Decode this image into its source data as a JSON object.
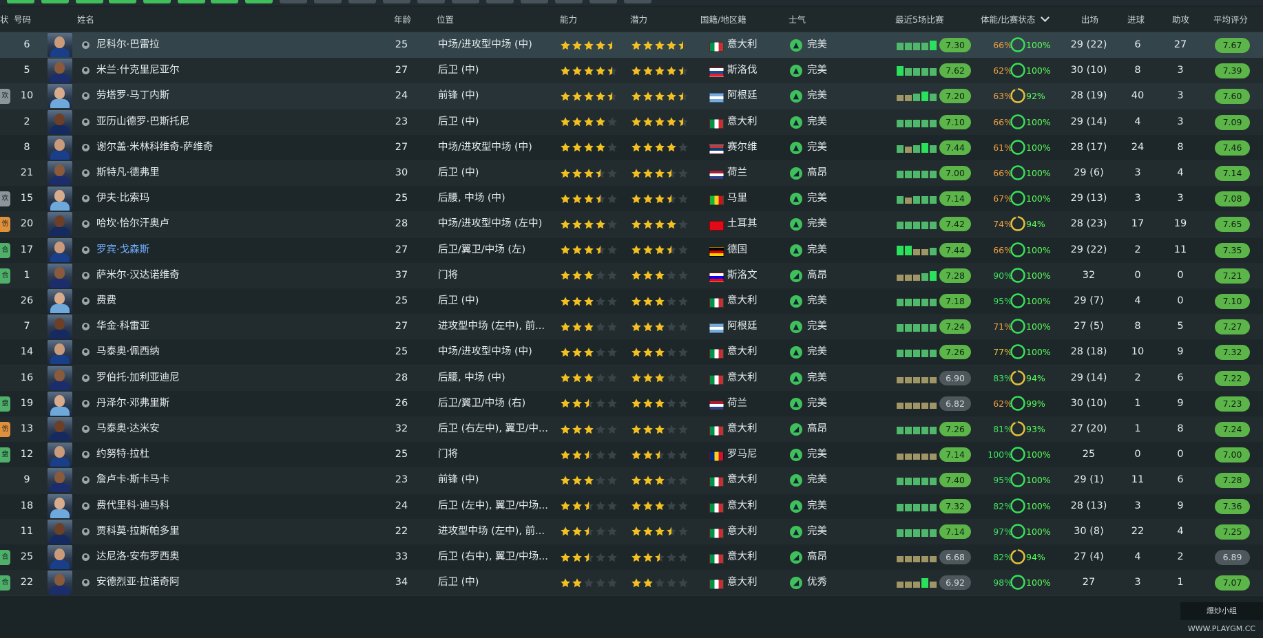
{
  "colors": {
    "good": "#3fc05a",
    "great": "#1ee05a",
    "warn": "#e4c23a",
    "grey": "#525c60",
    "orange": "#f0a040"
  },
  "header": {
    "status_col": "状",
    "number": "号码",
    "name": "姓名",
    "age": "年龄",
    "position": "位置",
    "ability": "能力",
    "potential": "潜力",
    "nationality": "国籍/地区籍",
    "morale": "士气",
    "recent_form": "最近5场比赛",
    "condition": "体能/比赛状态",
    "apps": "出场",
    "goals": "进球",
    "assists": "助攻",
    "avg_rating": "平均评分"
  },
  "players": [
    {
      "tag": "",
      "tag_color": "",
      "number": "6",
      "name": "尼科尔·巴雷拉",
      "age": "25",
      "position": "中场/进攻型中场 (中)",
      "ca": 4.5,
      "pa": 4.5,
      "flag": "italy",
      "nation": "意大利",
      "morale": "完美",
      "morale_icon": "up-icon",
      "form": [
        2,
        2,
        2,
        2,
        3
      ],
      "last": "7.30",
      "last_color": "good",
      "fitness": "66%",
      "fit_color": "orange",
      "cond": "100%",
      "apps": "29 (22)",
      "goals": "6",
      "assists": "27",
      "avg": "7.67",
      "avg_color": "good"
    },
    {
      "tag": "",
      "tag_color": "",
      "number": "5",
      "name": "米兰·什克里尼亚尔",
      "age": "27",
      "position": "后卫 (中)",
      "ca": 4.5,
      "pa": 4.5,
      "flag": "slovakia",
      "nation": "斯洛伐",
      "morale": "完美",
      "morale_icon": "up-icon",
      "form": [
        3,
        2,
        2,
        2,
        2
      ],
      "last": "7.62",
      "last_color": "good",
      "fitness": "62%",
      "fit_color": "orange",
      "cond": "100%",
      "apps": "30 (10)",
      "goals": "8",
      "assists": "3",
      "avg": "7.39",
      "avg_color": "good"
    },
    {
      "tag": "欢",
      "tag_color": "#8b959a",
      "number": "10",
      "name": "劳塔罗·马丁内斯",
      "age": "24",
      "position": "前锋 (中)",
      "ca": 4.5,
      "pa": 4.5,
      "flag": "argentina",
      "nation": "阿根廷",
      "morale": "完美",
      "morale_icon": "up-icon",
      "form": [
        1,
        1,
        2,
        3,
        2
      ],
      "last": "7.20",
      "last_color": "good",
      "fitness": "63%",
      "fit_color": "orange",
      "cond": "92%",
      "apps": "28 (19)",
      "goals": "40",
      "assists": "3",
      "avg": "7.60",
      "avg_color": "good"
    },
    {
      "tag": "",
      "tag_color": "",
      "number": "2",
      "name": "亚历山德罗·巴斯托尼",
      "age": "23",
      "position": "后卫 (中)",
      "ca": 4,
      "pa": 4.5,
      "flag": "italy",
      "nation": "意大利",
      "morale": "完美",
      "morale_icon": "up-icon",
      "form": [
        2,
        2,
        2,
        2,
        2
      ],
      "last": "7.10",
      "last_color": "good",
      "fitness": "66%",
      "fit_color": "orange",
      "cond": "100%",
      "apps": "29 (14)",
      "goals": "4",
      "assists": "3",
      "avg": "7.09",
      "avg_color": "good"
    },
    {
      "tag": "",
      "tag_color": "",
      "number": "8",
      "name": "谢尔盖·米林科维奇-萨维奇",
      "age": "27",
      "position": "中场/进攻型中场 (中)",
      "ca": 4,
      "pa": 4,
      "flag": "serbia",
      "nation": "赛尔维",
      "morale": "完美",
      "morale_icon": "up-icon",
      "form": [
        2,
        1,
        2,
        3,
        2
      ],
      "last": "7.44",
      "last_color": "good",
      "fitness": "61%",
      "fit_color": "orange",
      "cond": "100%",
      "apps": "28 (17)",
      "goals": "24",
      "assists": "8",
      "avg": "7.46",
      "avg_color": "good"
    },
    {
      "tag": "",
      "tag_color": "",
      "number": "21",
      "name": "斯特凡·德弗里",
      "age": "30",
      "position": "后卫 (中)",
      "ca": 3.5,
      "pa": 3.5,
      "flag": "netherlands",
      "nation": "荷兰",
      "morale": "高昂",
      "morale_icon": "flag-icon",
      "form": [
        2,
        2,
        2,
        2,
        2
      ],
      "last": "7.00",
      "last_color": "good",
      "fitness": "66%",
      "fit_color": "orange",
      "cond": "100%",
      "apps": "29 (6)",
      "goals": "3",
      "assists": "4",
      "avg": "7.14",
      "avg_color": "good"
    },
    {
      "tag": "欢",
      "tag_color": "#8b959a",
      "number": "15",
      "name": "伊夫·比索玛",
      "age": "25",
      "position": "后腰, 中场 (中)",
      "ca": 3.5,
      "pa": 3.5,
      "flag": "mali",
      "nation": "马里",
      "morale": "完美",
      "morale_icon": "up-icon",
      "form": [
        2,
        1,
        2,
        2,
        2
      ],
      "last": "7.14",
      "last_color": "good",
      "fitness": "67%",
      "fit_color": "orange",
      "cond": "100%",
      "apps": "29 (13)",
      "goals": "3",
      "assists": "3",
      "avg": "7.08",
      "avg_color": "good"
    },
    {
      "tag": "伤",
      "tag_color": "#e0903a",
      "number": "20",
      "name": "哈坎·恰尔汗奥卢",
      "age": "28",
      "position": "中场/进攻型中场 (左中)",
      "ca": 4,
      "pa": 4,
      "flag": "turkey",
      "nation": "土耳其",
      "morale": "完美",
      "morale_icon": "up-icon",
      "form": [
        2,
        2,
        2,
        2,
        2
      ],
      "last": "7.42",
      "last_color": "good",
      "fitness": "74%",
      "fit_color": "orange",
      "cond": "94%",
      "apps": "28 (23)",
      "goals": "17",
      "assists": "19",
      "avg": "7.65",
      "avg_color": "good"
    },
    {
      "tag": "合",
      "tag_color": "#4fb06a",
      "number": "17",
      "name": "罗宾·戈森斯",
      "age": "27",
      "position": "后卫/翼卫/中场 (左)",
      "ca": 3.5,
      "pa": 3.5,
      "flag": "germany",
      "nation": "德国",
      "morale": "完美",
      "morale_icon": "up-icon",
      "form": [
        3,
        3,
        1,
        1,
        2
      ],
      "last": "7.44",
      "last_color": "good",
      "fitness": "66%",
      "fit_color": "orange",
      "cond": "100%",
      "apps": "29 (22)",
      "goals": "2",
      "assists": "11",
      "avg": "7.35",
      "avg_color": "good",
      "link": true
    },
    {
      "tag": "合",
      "tag_color": "#4fb06a",
      "number": "1",
      "name": "萨米尔·汉达诺维奇",
      "age": "37",
      "position": "门将",
      "ca": 3,
      "pa": 3,
      "flag": "slovenia",
      "nation": "斯洛文",
      "morale": "高昂",
      "morale_icon": "flag-icon",
      "form": [
        1,
        1,
        1,
        2,
        3
      ],
      "last": "7.28",
      "last_color": "good",
      "fitness": "90%",
      "fit_color": "good",
      "cond": "100%",
      "apps": "32",
      "goals": "0",
      "assists": "0",
      "avg": "7.21",
      "avg_color": "good"
    },
    {
      "tag": "",
      "tag_color": "",
      "number": "26",
      "name": "费费",
      "age": "25",
      "position": "后卫 (中)",
      "ca": 3,
      "pa": 3,
      "flag": "italy",
      "nation": "意大利",
      "morale": "完美",
      "morale_icon": "up-icon",
      "form": [
        2,
        2,
        2,
        2,
        2
      ],
      "last": "7.18",
      "last_color": "good",
      "fitness": "95%",
      "fit_color": "good",
      "cond": "100%",
      "apps": "29 (7)",
      "goals": "4",
      "assists": "0",
      "avg": "7.10",
      "avg_color": "good"
    },
    {
      "tag": "",
      "tag_color": "",
      "number": "7",
      "name": "华金·科雷亚",
      "age": "27",
      "position": "进攻型中场 (左中), 前...",
      "ca": 3,
      "pa": 3,
      "flag": "argentina",
      "nation": "阿根廷",
      "morale": "完美",
      "morale_icon": "up-icon",
      "form": [
        2,
        2,
        2,
        2,
        2
      ],
      "last": "7.24",
      "last_color": "good",
      "fitness": "71%",
      "fit_color": "orange",
      "cond": "100%",
      "apps": "27 (5)",
      "goals": "8",
      "assists": "5",
      "avg": "7.27",
      "avg_color": "good"
    },
    {
      "tag": "",
      "tag_color": "",
      "number": "14",
      "name": "马泰奥·佩西纳",
      "age": "25",
      "position": "中场/进攻型中场 (中)",
      "ca": 3,
      "pa": 3,
      "flag": "italy",
      "nation": "意大利",
      "morale": "完美",
      "morale_icon": "up-icon",
      "form": [
        2,
        2,
        2,
        2,
        2
      ],
      "last": "7.26",
      "last_color": "good",
      "fitness": "77%",
      "fit_color": "warn",
      "cond": "100%",
      "apps": "28 (18)",
      "goals": "10",
      "assists": "9",
      "avg": "7.32",
      "avg_color": "good"
    },
    {
      "tag": "",
      "tag_color": "",
      "number": "16",
      "name": "罗伯托·加利亚迪尼",
      "age": "28",
      "position": "后腰, 中场 (中)",
      "ca": 3,
      "pa": 3,
      "flag": "italy",
      "nation": "意大利",
      "morale": "完美",
      "morale_icon": "up-icon",
      "form": [
        1,
        1,
        1,
        1,
        1
      ],
      "last": "6.90",
      "last_color": "grey",
      "fitness": "83%",
      "fit_color": "good",
      "cond": "94%",
      "apps": "29 (14)",
      "goals": "2",
      "assists": "6",
      "avg": "7.22",
      "avg_color": "good"
    },
    {
      "tag": "盘",
      "tag_color": "#4fb06a",
      "number": "19",
      "name": "丹泽尔·邓弗里斯",
      "age": "26",
      "position": "后卫/翼卫/中场 (右)",
      "ca": 2.5,
      "pa": 3,
      "flag": "netherlands",
      "nation": "荷兰",
      "morale": "完美",
      "morale_icon": "up-icon",
      "form": [
        1,
        1,
        1,
        1,
        1
      ],
      "last": "6.82",
      "last_color": "grey",
      "fitness": "62%",
      "fit_color": "orange",
      "cond": "99%",
      "apps": "30 (10)",
      "goals": "1",
      "assists": "9",
      "avg": "7.23",
      "avg_color": "good"
    },
    {
      "tag": "伤",
      "tag_color": "#e0903a",
      "number": "13",
      "name": "马泰奥·达米安",
      "age": "32",
      "position": "后卫 (右左中), 翼卫/中...",
      "ca": 3,
      "pa": 3,
      "flag": "italy",
      "nation": "意大利",
      "morale": "高昂",
      "morale_icon": "flag-icon",
      "form": [
        2,
        2,
        2,
        2,
        2
      ],
      "last": "7.26",
      "last_color": "good",
      "fitness": "81%",
      "fit_color": "good",
      "cond": "93%",
      "apps": "27 (20)",
      "goals": "1",
      "assists": "8",
      "avg": "7.24",
      "avg_color": "good"
    },
    {
      "tag": "盘",
      "tag_color": "#4fb06a",
      "number": "12",
      "name": "约努特·拉杜",
      "age": "25",
      "position": "门将",
      "ca": 2.5,
      "pa": 2.5,
      "flag": "romania",
      "nation": "罗马尼",
      "morale": "完美",
      "morale_icon": "up-icon",
      "form": [
        1,
        1,
        1,
        1,
        1
      ],
      "last": "7.14",
      "last_color": "good",
      "fitness": "100%",
      "fit_color": "good",
      "cond": "100%",
      "apps": "25",
      "goals": "0",
      "assists": "0",
      "avg": "7.00",
      "avg_color": "good"
    },
    {
      "tag": "",
      "tag_color": "",
      "number": "9",
      "name": "詹卢卡·斯卡马卡",
      "age": "23",
      "position": "前锋 (中)",
      "ca": 3,
      "pa": 3,
      "flag": "italy",
      "nation": "意大利",
      "morale": "完美",
      "morale_icon": "up-icon",
      "form": [
        2,
        2,
        2,
        2,
        2
      ],
      "last": "7.40",
      "last_color": "good",
      "fitness": "95%",
      "fit_color": "good",
      "cond": "100%",
      "apps": "29 (1)",
      "goals": "11",
      "assists": "6",
      "avg": "7.28",
      "avg_color": "good"
    },
    {
      "tag": "",
      "tag_color": "",
      "number": "18",
      "name": "费代里科·迪马科",
      "age": "24",
      "position": "后卫 (左中), 翼卫/中场...",
      "ca": 2.5,
      "pa": 3,
      "flag": "italy",
      "nation": "意大利",
      "morale": "完美",
      "morale_icon": "up-icon",
      "form": [
        2,
        2,
        2,
        2,
        2
      ],
      "last": "7.32",
      "last_color": "good",
      "fitness": "82%",
      "fit_color": "good",
      "cond": "100%",
      "apps": "28 (13)",
      "goals": "3",
      "assists": "9",
      "avg": "7.36",
      "avg_color": "good"
    },
    {
      "tag": "",
      "tag_color": "",
      "number": "11",
      "name": "贾科莫·拉斯帕多里",
      "age": "22",
      "position": "进攻型中场 (左中), 前...",
      "ca": 2.5,
      "pa": 3.5,
      "flag": "italy",
      "nation": "意大利",
      "morale": "完美",
      "morale_icon": "up-icon",
      "form": [
        2,
        2,
        2,
        2,
        2
      ],
      "last": "7.14",
      "last_color": "good",
      "fitness": "97%",
      "fit_color": "good",
      "cond": "100%",
      "apps": "30 (8)",
      "goals": "22",
      "assists": "4",
      "avg": "7.25",
      "avg_color": "good"
    },
    {
      "tag": "合",
      "tag_color": "#4fb06a",
      "number": "25",
      "name": "达尼洛·安布罗西奥",
      "age": "33",
      "position": "后卫 (右中), 翼卫/中场...",
      "ca": 2.5,
      "pa": 2.5,
      "flag": "italy",
      "nation": "意大利",
      "morale": "高昂",
      "morale_icon": "flag-icon",
      "form": [
        1,
        1,
        1,
        1,
        1
      ],
      "last": "6.68",
      "last_color": "grey",
      "fitness": "82%",
      "fit_color": "good",
      "cond": "94%",
      "apps": "27 (4)",
      "goals": "4",
      "assists": "2",
      "avg": "6.89",
      "avg_color": "grey"
    },
    {
      "tag": "合",
      "tag_color": "#4fb06a",
      "number": "22",
      "name": "安德烈亚·拉诺奇阿",
      "age": "34",
      "position": "后卫 (中)",
      "ca": 2,
      "pa": 2,
      "flag": "italy",
      "nation": "意大利",
      "morale": "优秀",
      "morale_icon": "flag-icon",
      "form": [
        1,
        1,
        1,
        3,
        1
      ],
      "last": "6.92",
      "last_color": "grey",
      "fitness": "98%",
      "fit_color": "good",
      "cond": "100%",
      "apps": "27",
      "goals": "3",
      "assists": "1",
      "avg": "7.07",
      "avg_color": "good"
    }
  ],
  "watermark": "爆炒小组 WWW.PLAYGM.CC"
}
